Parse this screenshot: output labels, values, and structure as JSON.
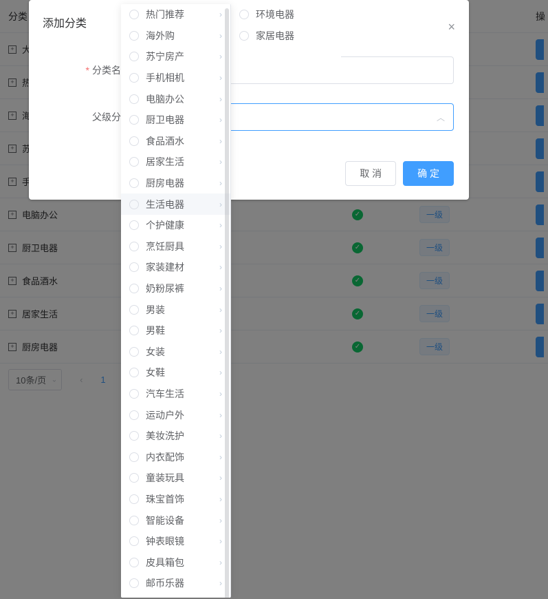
{
  "background": {
    "header_category": "分类",
    "header_ops": "操",
    "rows": [
      "大家",
      "热门",
      "海外",
      "苏宁",
      "手机",
      "电脑办公",
      "厨卫电器",
      "食品酒水",
      "居家生活",
      "厨房电器"
    ],
    "level_tag": "一级",
    "pager_size": "10条/页",
    "pager_current": "1"
  },
  "modal": {
    "title": "添加分类",
    "label_name": "分类名称",
    "label_parent": "父级分类",
    "cancel": "取 消",
    "confirm": "确 定"
  },
  "cascader": {
    "panel1": [
      "热门推荐",
      "海外购",
      "苏宁房产",
      "手机相机",
      "电脑办公",
      "厨卫电器",
      "食品酒水",
      "居家生活",
      "厨房电器",
      "生活电器",
      "个护健康",
      "烹饪厨具",
      "家装建材",
      "奶粉尿裤",
      "男装",
      "男鞋",
      "女装",
      "女鞋",
      "汽车生活",
      "运动户外",
      "美妆洗护",
      "内衣配饰",
      "童装玩具",
      "珠宝首饰",
      "智能设备",
      "钟表眼镜",
      "皮具箱包",
      "邮币乐器"
    ],
    "active_index": 9,
    "panel2": [
      "环境电器",
      "家居电器"
    ]
  }
}
